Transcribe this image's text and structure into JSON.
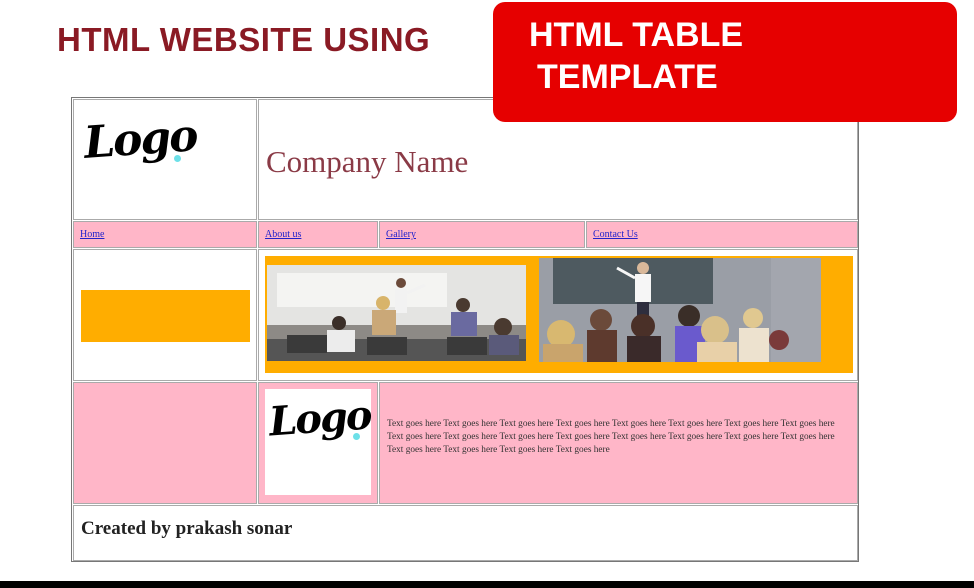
{
  "slide": {
    "title": "HTML WEBSITE  USING",
    "banner_line1": "HTML TABLE",
    "banner_line2": "TEMPLATE"
  },
  "header": {
    "logo_text": "Logo",
    "company_name": "Company Name"
  },
  "nav": {
    "items": [
      {
        "label": "Home"
      },
      {
        "label": "About us"
      },
      {
        "label": "Gallery"
      },
      {
        "label": "Contact Us"
      }
    ]
  },
  "content": {
    "logo_text": "Logo",
    "body_text": "Text goes here Text goes here Text goes here Text goes here Text goes here Text goes here Text goes here Text goes here Text goes here Text goes here Text goes here Text goes here Text goes here Text goes here Text goes here Text goes here Text goes here Text goes here Text goes here Text goes here"
  },
  "footer": {
    "text": "Created by prakash sonar"
  },
  "colors": {
    "title": "#8a1a24",
    "banner": "#e60000",
    "pink": "#ffb6c8",
    "orange": "#ffad00",
    "link": "#2222cc"
  }
}
